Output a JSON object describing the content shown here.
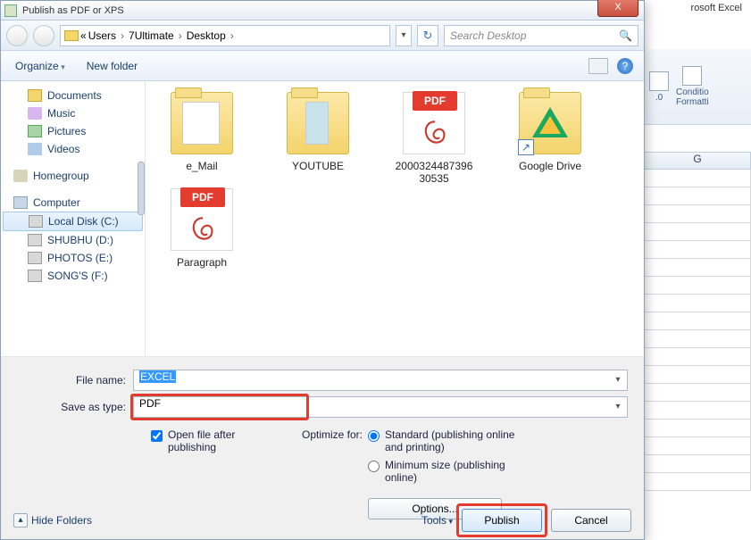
{
  "excel": {
    "title": "rosoft Excel",
    "ribbon1": "Conditio",
    "ribbon2": "Formatti",
    "col": "G"
  },
  "dialog": {
    "title": "Publish as PDF or XPS",
    "close": "X"
  },
  "nav": {
    "crumbs": [
      "Users",
      "7Ultimate",
      "Desktop"
    ],
    "search_placeholder": "Search Desktop"
  },
  "toolbar": {
    "organize": "Organize",
    "newfolder": "New folder",
    "help": "?"
  },
  "tree": {
    "documents": "Documents",
    "music": "Music",
    "pictures": "Pictures",
    "videos": "Videos",
    "homegroup": "Homegroup",
    "computer": "Computer",
    "localdisk": "Local Disk (C:)",
    "shubhu": "SHUBHU (D:)",
    "photos": "PHOTOS (E:)",
    "songs": "SONG'S (F:)"
  },
  "files": {
    "f1": "e_Mail",
    "f2": "YOUTUBE",
    "f3": "2000324487396\n30535",
    "f4": "Google Drive",
    "f5": "Paragraph",
    "pdf_badge": "PDF"
  },
  "form": {
    "filename_label": "File name:",
    "filename_value": "EXCEL",
    "savetype_label": "Save as type:",
    "savetype_value": "PDF",
    "openafter": "Open file after publishing",
    "optimize_label": "Optimize for:",
    "opt_standard": "Standard (publishing online and printing)",
    "opt_min": "Minimum size (publishing online)",
    "options_btn": "Options..."
  },
  "footer": {
    "hide": "Hide Folders",
    "tools": "Tools",
    "publish": "Publish",
    "cancel": "Cancel"
  }
}
